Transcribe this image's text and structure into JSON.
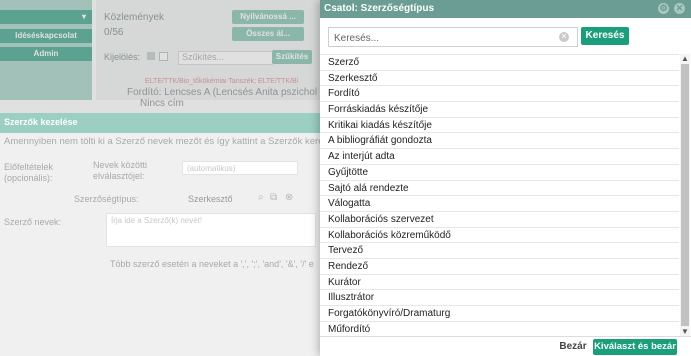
{
  "background": {
    "left_buttons": [
      "",
      "Idéséskapcsolat",
      "Admin"
    ],
    "publications_label": "Közlemények",
    "publications_count": "0/56",
    "registrable_btn": "Nyilvánossá ...",
    "all_btn": "Összes ál...",
    "selection_label": "Kijelölés:",
    "filter_placeholder": "Szűkítés...",
    "filter_btn": "Szűkítés",
    "snippet_red": "ELTE/TTK/Bio_tőkökémiai Tanszék; ELTE/TTK/Bi",
    "snippet_translator": "Fordító: Lencses A (Lencsés Anita pszichol",
    "snippet_no_title": "Nincs cím"
  },
  "authors_dialog": {
    "title": "Szerzők kezelése",
    "info": "Amennyiben nem tölti ki a Szerző nevek mezőt és így kattint a Szerzők keresé",
    "prefix_label_1": "Előfeltételek",
    "prefix_label_2": "(opcionális):",
    "separator_label_1": "Nevek közötti",
    "separator_label_2": "elválasztójel:",
    "separator_value": "(automatikus)",
    "authorship_type_label": "Szerzőségtípus:",
    "authorship_type_value": "Szerkesztő",
    "author_names_label": "Szerző nevek:",
    "author_names_placeholder": "Írja ide a Szerző(k) nevét!",
    "multi_author_hint": "Több szerző esetén a neveket a ',', ';', 'and', '&', '/' e"
  },
  "modal": {
    "title": "Csatol: Szerzőségtípus",
    "search_placeholder": "Keresés...",
    "search_button": "Keresés",
    "items": [
      "Szerző",
      "Szerkesztő",
      "Fordító",
      "Forráskiadás készítője",
      "Kritikai kiadás készítője",
      "A bibliográfiát gondozta",
      "Az interjút adta",
      "Gyűjtötte",
      "Sajtó alá rendezte",
      "Válogatta",
      "Kollaborációs szervezet",
      "Kollaborációs közreműködő",
      "Tervező",
      "Rendező",
      "Kurátor",
      "Illusztrátor",
      "Forgatókönyvíró/Dramaturg",
      "Műfordító"
    ],
    "close_button": "Bezár",
    "select_close_button": "Kiválaszt és bezár"
  },
  "colors": {
    "accent": "#1a9e7c",
    "header": "#6b9d94"
  },
  "icons": [
    "close-icon",
    "clear-search-icon",
    "search-icon",
    "copy-icon",
    "remove-icon",
    "chevron-down-icon"
  ]
}
